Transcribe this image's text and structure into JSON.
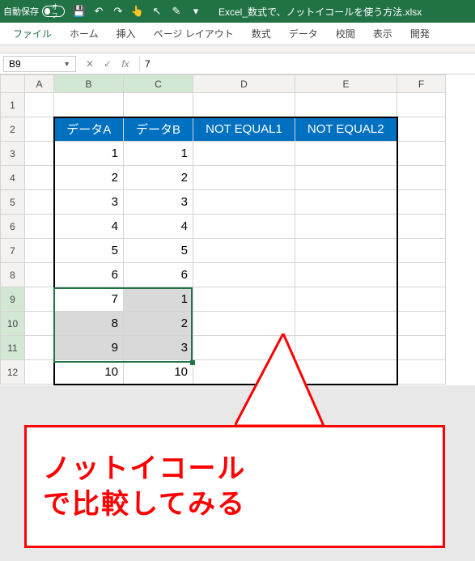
{
  "titlebar": {
    "autosave_label": "自動保存",
    "autosave_state": "オフ",
    "filename": "Excel_数式で、ノットイコールを使う方法.xlsx"
  },
  "qat_icons": {
    "save": "💾",
    "undo": "↶",
    "redo": "↷",
    "touch": "👆",
    "cursor": "↖",
    "ink": "✎",
    "more": "▾"
  },
  "ribbon": {
    "file": "ファイル",
    "home": "ホーム",
    "insert": "挿入",
    "page_layout": "ページ レイアウト",
    "formulas": "数式",
    "data": "データ",
    "review": "校閲",
    "view": "表示",
    "developer": "開発"
  },
  "namebox": {
    "value": "B9"
  },
  "fx": {
    "cancel": "✕",
    "confirm": "✓",
    "fx": "fx"
  },
  "formula_bar": {
    "value": "7"
  },
  "columns": [
    "A",
    "B",
    "C",
    "D",
    "E",
    "F"
  ],
  "rows": [
    "1",
    "2",
    "3",
    "4",
    "5",
    "6",
    "7",
    "8",
    "9",
    "10",
    "11",
    "12"
  ],
  "headers": {
    "b": "データA",
    "c": "データB",
    "d": "NOT EQUAL1",
    "e": "NOT EQUAL2"
  },
  "dataA": [
    "1",
    "2",
    "3",
    "4",
    "5",
    "6",
    "7",
    "8",
    "9",
    "10"
  ],
  "dataB": [
    "1",
    "2",
    "3",
    "4",
    "5",
    "6",
    "1",
    "2",
    "3",
    "10"
  ],
  "callout": {
    "line1": "ノットイコール",
    "line2": "で比較してみる"
  },
  "chart_data": {
    "type": "table",
    "title": "",
    "columns": [
      "データA",
      "データB",
      "NOT EQUAL1",
      "NOT EQUAL2"
    ],
    "rows": [
      [
        1,
        1,
        null,
        null
      ],
      [
        2,
        2,
        null,
        null
      ],
      [
        3,
        3,
        null,
        null
      ],
      [
        4,
        4,
        null,
        null
      ],
      [
        5,
        5,
        null,
        null
      ],
      [
        6,
        6,
        null,
        null
      ],
      [
        7,
        1,
        null,
        null
      ],
      [
        8,
        2,
        null,
        null
      ],
      [
        9,
        3,
        null,
        null
      ],
      [
        10,
        10,
        null,
        null
      ]
    ],
    "selection": "B9:C11",
    "active_cell": "B9"
  }
}
